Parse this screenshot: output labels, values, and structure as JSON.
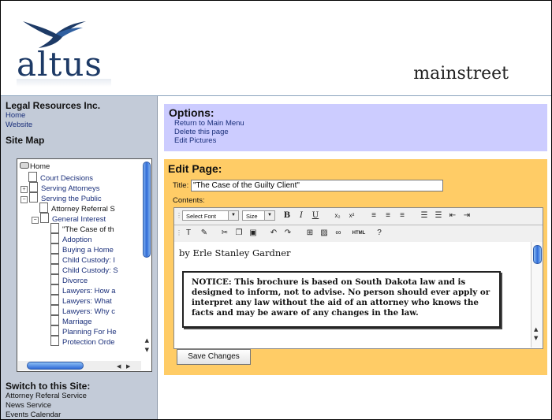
{
  "header": {
    "logo_text": "altus",
    "site_name": "mainstreet"
  },
  "sidebar": {
    "org_title": "Legal Resources Inc.",
    "links": [
      "Home",
      "Website"
    ],
    "site_map_heading": "Site Map",
    "tree": [
      {
        "label": "Home",
        "icon": "folder-icon"
      },
      {
        "label": "Court Decisions",
        "icon": "page-icon"
      },
      {
        "label": "Serving Attorneys",
        "icon": "page-icon",
        "toggle": "+"
      },
      {
        "label": "Serving the Public",
        "icon": "page-icon",
        "toggle": "−"
      },
      {
        "label": "Attorney Referral S",
        "icon": "page-icon"
      },
      {
        "label": "General Interest",
        "icon": "page-icon",
        "toggle": "−"
      },
      {
        "label": "\"The Case of th",
        "icon": "page-icon"
      },
      {
        "label": "Adoption",
        "icon": "page-icon"
      },
      {
        "label": "Buying a Home",
        "icon": "page-icon"
      },
      {
        "label": "Child Custody: I",
        "icon": "page-icon"
      },
      {
        "label": "Child Custody: S",
        "icon": "page-icon"
      },
      {
        "label": "Divorce",
        "icon": "page-icon"
      },
      {
        "label": "Lawyers: How a",
        "icon": "page-icon"
      },
      {
        "label": "Lawyers: What",
        "icon": "page-icon"
      },
      {
        "label": "Lawyers: Why c",
        "icon": "page-icon"
      },
      {
        "label": "Marriage",
        "icon": "page-icon"
      },
      {
        "label": "Planning For He",
        "icon": "page-icon"
      },
      {
        "label": "Protection Orde",
        "icon": "page-icon"
      }
    ],
    "switch_heading": "Switch to this Site:",
    "switch_links": [
      "Attorney Referal Service",
      "News Service",
      "Events Calendar"
    ]
  },
  "options": {
    "title": "Options:",
    "links": [
      "Return to Main Menu",
      "Delete this page",
      "Edit Pictures"
    ]
  },
  "edit": {
    "title": "Edit Page:",
    "title_label": "Title:",
    "title_value": "\"The Case of the Guilty Client\"",
    "contents_label": "Contents:",
    "font_select": "Select Font",
    "size_select": "Size",
    "toolbar_bold": "B",
    "toolbar_italic": "I",
    "toolbar_underline": "U",
    "toolbar_html": "HTML",
    "byline": "by Erle Stanley Gardner",
    "notice": "NOTICE: This brochure is based on South Dakota law and is designed to inform, not to advise. No person should ever apply or interpret any law without the aid of an attorney who knows the facts and may be aware of any changes in the law.",
    "save_label": "Save Changes"
  },
  "colors": {
    "options_bg": "#ccccff",
    "edit_bg": "#ffcc66",
    "sidebar_bg": "#c3cbd8",
    "link": "#1a2f7a"
  }
}
